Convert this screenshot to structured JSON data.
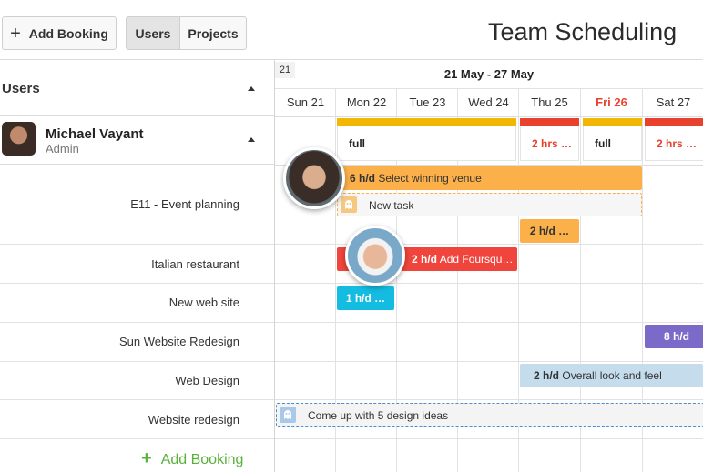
{
  "toolbar": {
    "add_booking_label": "Add Booking",
    "add_booking_icon": "plus-icon",
    "view_options": [
      "Users",
      "Projects"
    ],
    "selected_view": "Users",
    "title": "Team Scheduling"
  },
  "left_panel": {
    "header_label": "Users",
    "user": {
      "name": "Michael Vayant",
      "role": "Admin"
    },
    "projects": [
      "E11 - Event planning",
      "Italian restaurant",
      "New web site",
      "Sun Website Redesign",
      "Web Design",
      "Website redesign"
    ],
    "add_booking_label": "Add Booking"
  },
  "timeline": {
    "week_number": "21",
    "week_range": "21 May - 27 May",
    "days": [
      "Sun 21",
      "Mon 22",
      "Tue 23",
      "Wed 24",
      "Thu 25",
      "Fri 26",
      "Sat 27"
    ],
    "highlighted_day": "Fri 26",
    "load": [
      "full",
      "2 hrs …",
      "full",
      "2 hrs …"
    ]
  },
  "bookings": {
    "event_planning_main": {
      "hours": "6 h/d",
      "task": "Select winning venue"
    },
    "event_planning_new": {
      "task": "New task"
    },
    "event_planning_small": {
      "hours": "2 h/d …"
    },
    "italian": {
      "hours": "2 h/d",
      "task": "Add Foursqu…"
    },
    "new_web_site": {
      "hours": "1 h/d …"
    },
    "sun_redesign": {
      "hours": "8 h/d"
    },
    "web_design": {
      "hours": "2 h/d",
      "task": "Overall look and feel"
    },
    "website_redesign": {
      "task": "Come up with 5 design ideas"
    }
  },
  "colors": {
    "orange": "#fbb04a",
    "red": "#f0453c",
    "cyan": "#13bce0",
    "purple": "#7b6ac7",
    "light_blue": "#c4dcec",
    "strip_yellow": "#f2b705",
    "strip_red": "#e8412e",
    "add_green": "#58b13a",
    "weekend_red": "#e8412e"
  }
}
